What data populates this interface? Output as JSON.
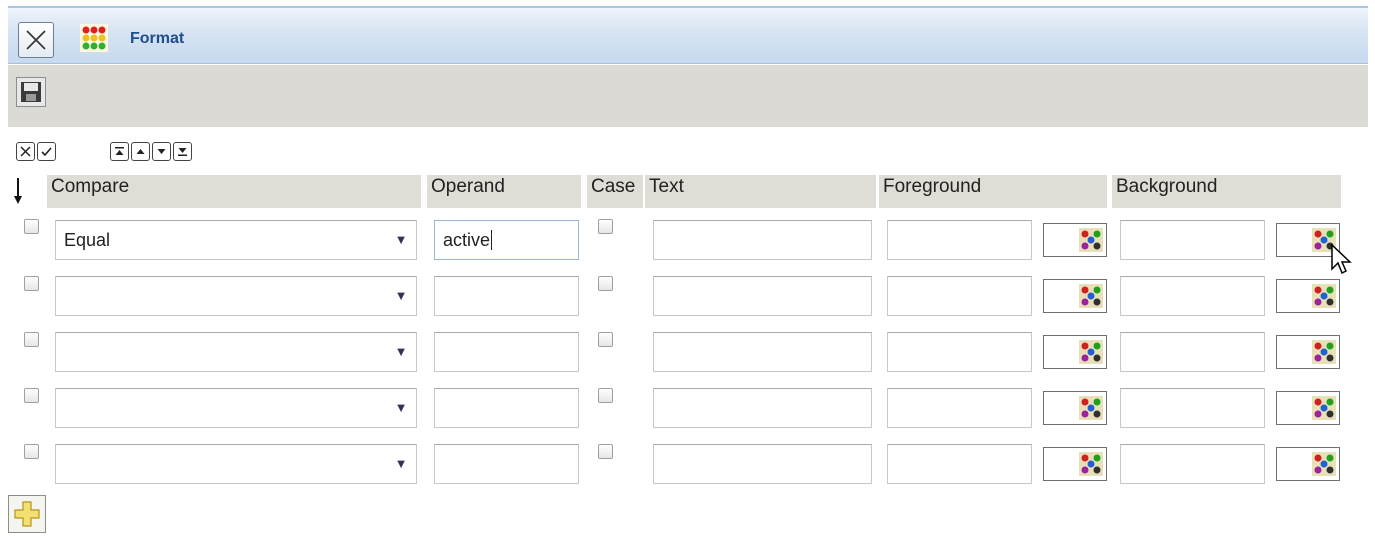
{
  "window": {
    "title": "Format"
  },
  "headers": {
    "compare": "Compare",
    "operand": "Operand",
    "case": "Case",
    "text": "Text",
    "foreground": "Foreground",
    "background": "Background"
  },
  "rows": [
    {
      "compare": "Equal",
      "operand": "active",
      "case": false,
      "text": "",
      "foreground": "",
      "background": ""
    },
    {
      "compare": "",
      "operand": "",
      "case": false,
      "text": "",
      "foreground": "",
      "background": ""
    },
    {
      "compare": "",
      "operand": "",
      "case": false,
      "text": "",
      "foreground": "",
      "background": ""
    },
    {
      "compare": "",
      "operand": "",
      "case": false,
      "text": "",
      "foreground": "",
      "background": ""
    },
    {
      "compare": "",
      "operand": "",
      "case": false,
      "text": "",
      "foreground": "",
      "background": ""
    }
  ],
  "icons": {
    "close": "close-icon",
    "app": "format-palette-icon",
    "save": "save-icon",
    "clear": "clear-icon",
    "apply": "check-icon",
    "move_top": "move-top-icon",
    "move_up": "move-up-icon",
    "move_down": "move-down-icon",
    "move_bottom": "move-bottom-icon",
    "add": "add-icon"
  },
  "colors": {
    "title": "#1f4e8c",
    "titlebar": "#c7d9ee",
    "toolbar": "#dcdad5",
    "header": "#e0ddd7"
  }
}
